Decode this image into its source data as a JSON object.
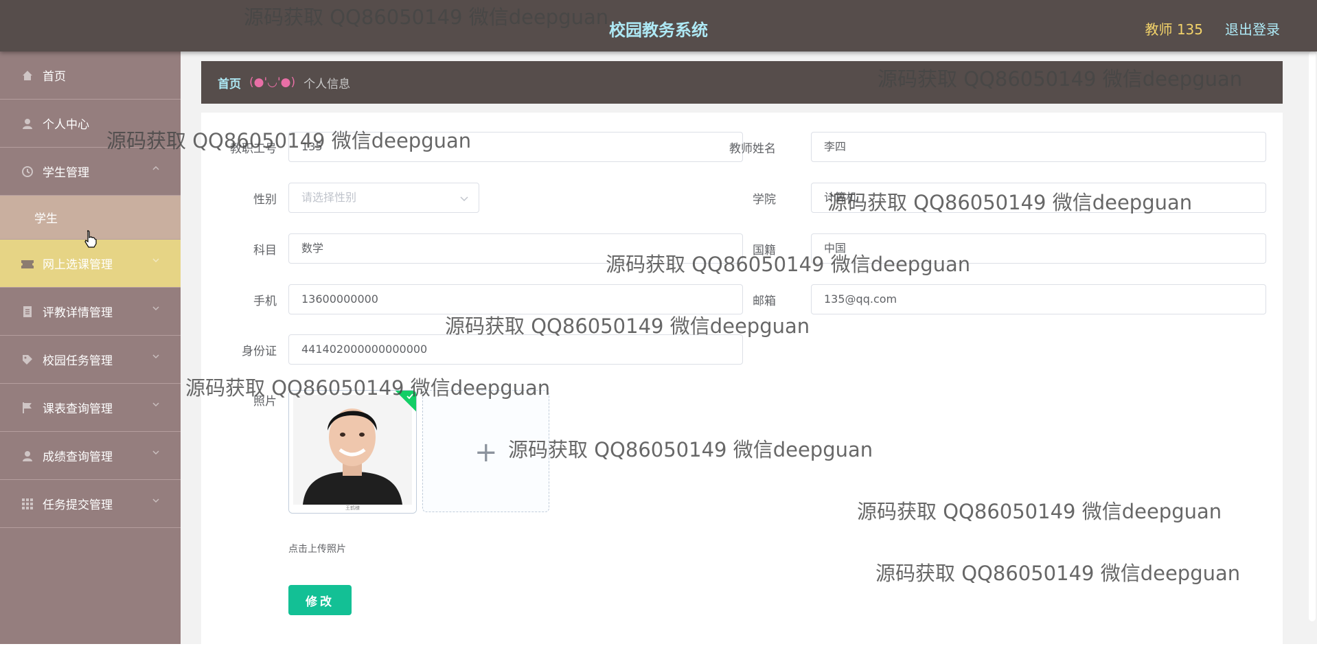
{
  "header": {
    "title": "校园教务系统",
    "user": "教师 135",
    "logout": "退出登录"
  },
  "sidebar": {
    "items": [
      {
        "label": "首页",
        "icon": "home-icon"
      },
      {
        "label": "个人中心",
        "icon": "user-icon"
      },
      {
        "label": "学生管理",
        "icon": "clock-icon"
      },
      {
        "label": "网上选课管理",
        "icon": "ticket-icon"
      },
      {
        "label": "评教详情管理",
        "icon": "document-icon"
      },
      {
        "label": "校园任务管理",
        "icon": "tag-icon"
      },
      {
        "label": "课表查询管理",
        "icon": "flag-icon"
      },
      {
        "label": "成绩查询管理",
        "icon": "user-icon"
      },
      {
        "label": "任务提交管理",
        "icon": "grid-icon"
      }
    ],
    "submenu": {
      "label": "学生"
    }
  },
  "breadcrumb": {
    "home": "首页",
    "separator": "(●'◡'●)",
    "current": "个人信息"
  },
  "form": {
    "fields": {
      "staff_no": {
        "label": "教职工号",
        "value": "135"
      },
      "teacher_name": {
        "label": "教师姓名",
        "value": "李四"
      },
      "gender": {
        "label": "性别",
        "placeholder": "请选择性别"
      },
      "college": {
        "label": "学院",
        "value": "计算机"
      },
      "subject": {
        "label": "科目",
        "value": "数学"
      },
      "nationality": {
        "label": "国籍",
        "value": "中国"
      },
      "phone": {
        "label": "手机",
        "value": "13600000000"
      },
      "email": {
        "label": "邮箱",
        "value": "135@qq.com"
      },
      "id_card": {
        "label": "身份证",
        "value": "441402000000000000"
      },
      "photo": {
        "label": "照片",
        "caption": "王鹤棣"
      }
    },
    "upload_tip": "点击上传照片",
    "submit": "修改"
  },
  "watermark": "源码获取 QQ86050149 微信deepguan",
  "colors": {
    "header_bg": "#564d4b",
    "sidebar_bg": "#957e7e",
    "active_menu": "#e6d485",
    "accent_title": "#aee9f5",
    "user_label": "#f3d36a",
    "button": "#13c095"
  }
}
